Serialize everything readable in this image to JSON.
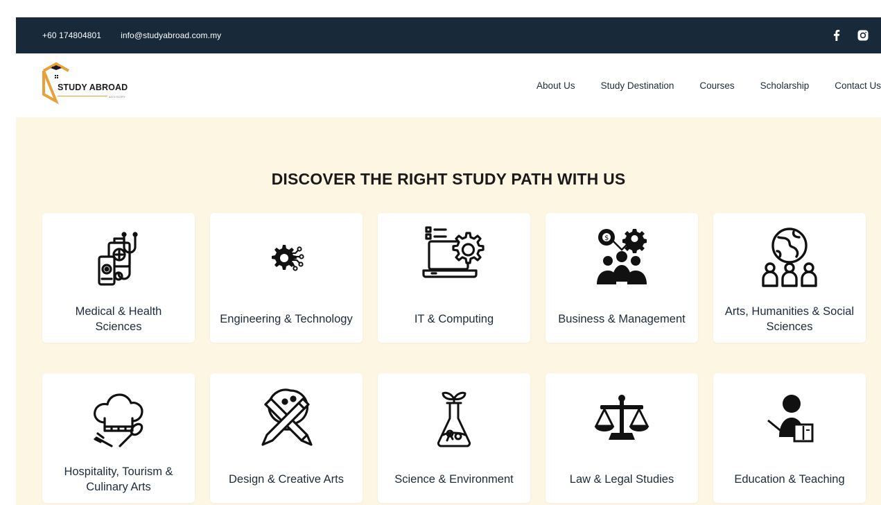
{
  "topbar": {
    "phone": "+60 174804801",
    "email": "info@studyabroad.com.my",
    "social": [
      "facebook-icon",
      "instagram-icon"
    ]
  },
  "logo": {
    "name": "STUDY ABROAD",
    "tagline": "ADVISORY",
    "accent": "#e8a13a"
  },
  "nav": {
    "items": [
      "About Us",
      "Study Destination",
      "Courses",
      "Scholarship",
      "Contact Us"
    ]
  },
  "hero": {
    "title": "DISCOVER THE RIGHT STUDY PATH WITH US",
    "background": "#fdf6e3"
  },
  "categories": [
    {
      "label": "Medical & Health Sciences",
      "icon": "medical-icon"
    },
    {
      "label": "Engineering & Technology",
      "icon": "engineering-icon"
    },
    {
      "label": "IT & Computing",
      "icon": "computing-icon"
    },
    {
      "label": "Business & Management",
      "icon": "business-icon"
    },
    {
      "label": "Arts, Humanities & Social Sciences",
      "icon": "humanities-icon"
    },
    {
      "label": "Hospitality, Tourism & Culinary Arts",
      "icon": "chef-hat-icon"
    },
    {
      "label": "Design & Creative Arts",
      "icon": "design-icon"
    },
    {
      "label": "Science & Environment",
      "icon": "flask-icon"
    },
    {
      "label": "Law & Legal Studies",
      "icon": "scales-icon"
    },
    {
      "label": "Education & Teaching",
      "icon": "teacher-icon"
    }
  ],
  "colors": {
    "topbar": "#18293a",
    "text": "#1d2b3a"
  }
}
